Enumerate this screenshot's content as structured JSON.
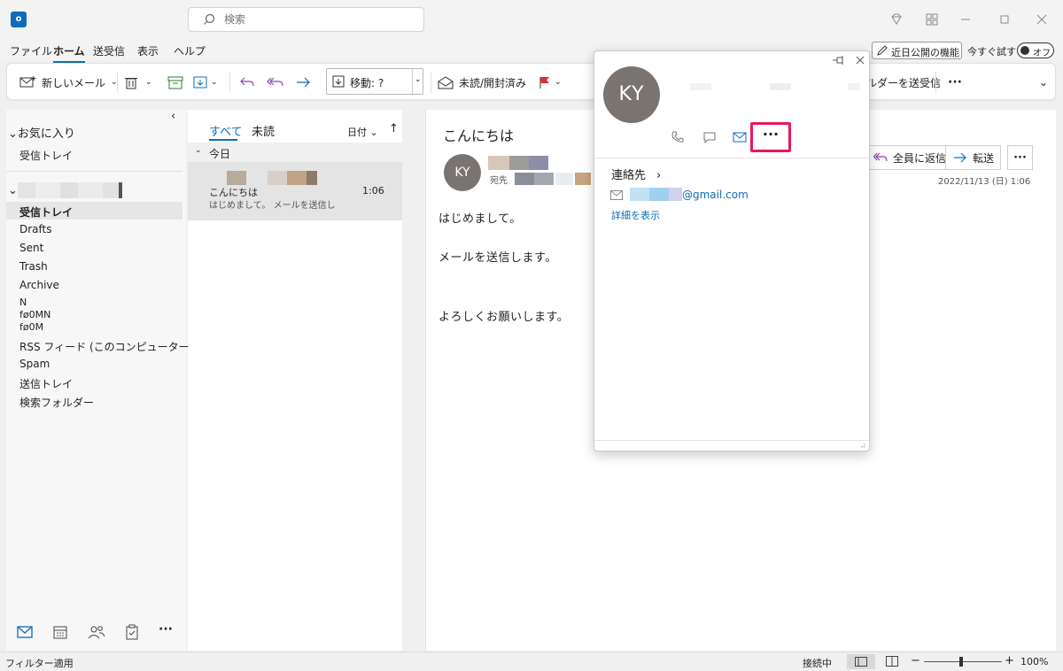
{
  "titlebar": {
    "search_placeholder": "検索"
  },
  "menu": {
    "tabs": [
      "ファイル",
      "ホーム",
      "送受信",
      "表示",
      "ヘルプ"
    ],
    "coming_soon": "近日公開の機能",
    "try_now": "今すぐ試す",
    "toggle": "オフ"
  },
  "ribbon": {
    "new_mail": "新しいメール",
    "move": "移動: ?",
    "unread_read": "未読/開封済み",
    "send_receive_folder": "ルダーを送受信",
    "more": "···"
  },
  "folders": {
    "favorites": "お気に入り",
    "fav_inbox": "受信トレイ",
    "items": [
      "受信トレイ",
      "Drafts",
      "Sent",
      "Trash",
      "Archive",
      "N",
      "fø0MN",
      "fø0M",
      "RSS フィード (このコンピューターのみ)",
      "Spam",
      "送信トレイ",
      "検索フォルダー"
    ]
  },
  "message_list": {
    "tab_all": "すべて",
    "tab_unread": "未読",
    "sort": "日付",
    "group": "今日",
    "item": {
      "subject": "こんにちは",
      "time": "1:06",
      "preview": "はじめまして。 メールを送信し"
    }
  },
  "reading": {
    "subject": "こんにちは",
    "avatar_initials": "KY",
    "to_label": "宛先",
    "reply_all": "全員に返信",
    "forward": "転送",
    "more": "···",
    "date": "2022/11/13 (日) 1:06",
    "body": [
      "はじめまして。",
      "メールを送信します。",
      "よろしくお願いします。"
    ]
  },
  "card": {
    "initials": "KY",
    "more": "···",
    "contacts": "連絡先",
    "email_domain": "@gmail.com",
    "show_details": "詳細を表示"
  },
  "statusbar": {
    "filter": "フィルター適用",
    "connected": "接続中",
    "zoom": "100%"
  },
  "colors": {
    "accent": "#0f6cbd",
    "highlight": "#e8185e",
    "avatar": "#7a7471"
  }
}
